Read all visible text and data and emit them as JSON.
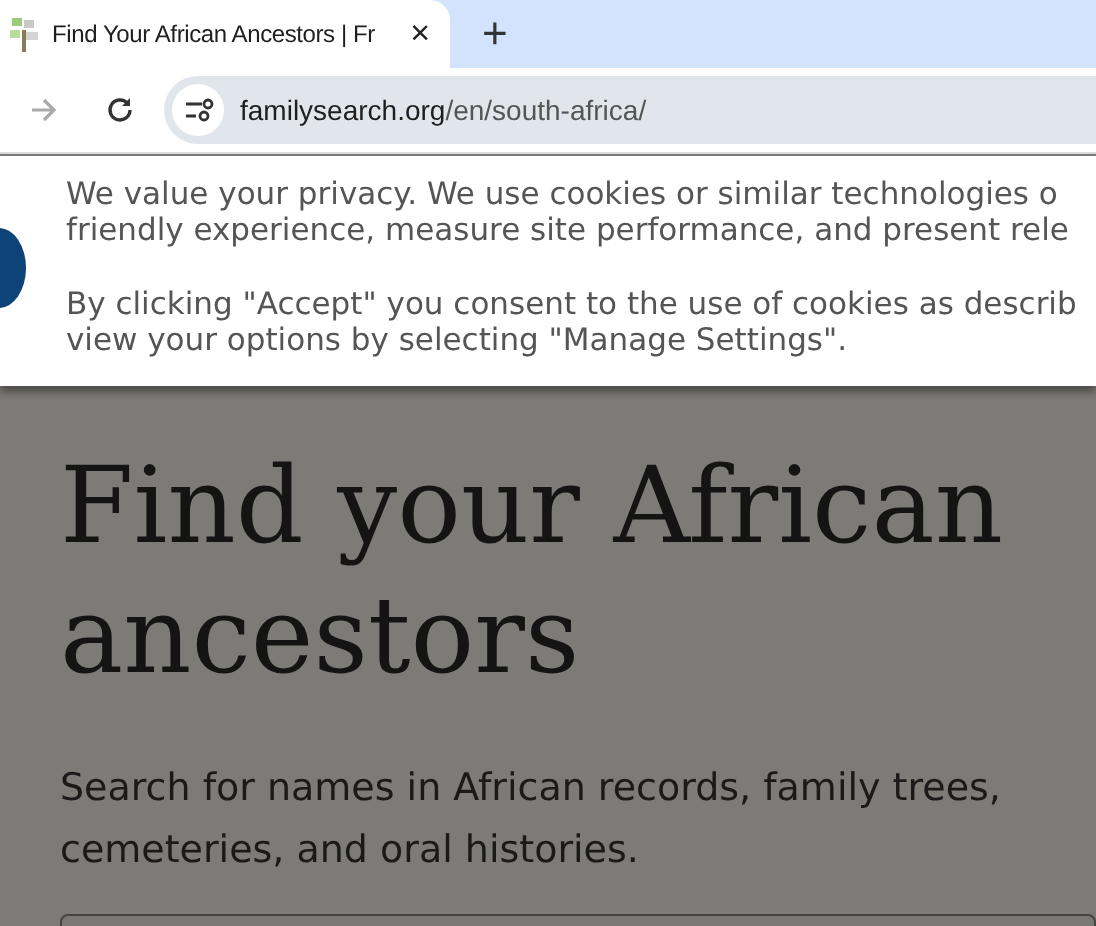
{
  "browser": {
    "tab": {
      "title": "Find Your African Ancestors | Fr",
      "selected": true
    },
    "new_tab": "+",
    "close": "×",
    "url_host": "familysearch.org",
    "url_path": "/en/south-africa/"
  },
  "cookie_banner": {
    "paragraphs": [
      [
        "We value your privacy. We use cookies or similar technologies o",
        "friendly experience, measure site performance, and present rele"
      ],
      [
        "By clicking \"Accept\" you consent to the use of cookies as describ",
        "view your options by selecting \"Manage Settings\"."
      ]
    ]
  },
  "page": {
    "heading": [
      "Find your African",
      "ancestors"
    ],
    "subtitle": [
      "Search for names in African records, family trees,",
      "cemeteries, and oral histories."
    ]
  }
}
